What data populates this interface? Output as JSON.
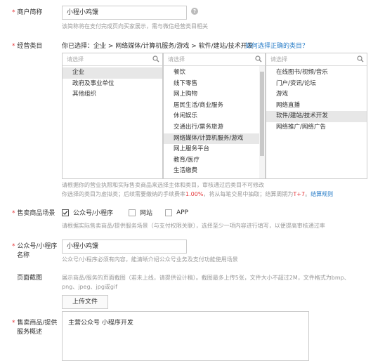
{
  "merchant_name": {
    "required_mark": "*",
    "label": "商户简称",
    "value": "小程小鸡馕",
    "help_glyph": "?",
    "hint": "该简称将在支付完成页向买家展示，需与微信经营类目相关"
  },
  "business_category": {
    "required_mark": "*",
    "label": "经营类目",
    "selected_path": "你已选择：企业 > 网络媒体/计算机服务/游戏 > 软件/建站/技术开发",
    "how_to_link": "如何选择正确的类目？",
    "columns": [
      {
        "placeholder": "请选择",
        "items": [
          {
            "label": "企业",
            "selected": true
          },
          {
            "label": "政府及事业单位",
            "selected": false
          },
          {
            "label": "其他组织",
            "selected": false
          }
        ]
      },
      {
        "placeholder": "请选择",
        "items": [
          {
            "label": "餐饮",
            "selected": false
          },
          {
            "label": "线下零售",
            "selected": false
          },
          {
            "label": "网上购物",
            "selected": false
          },
          {
            "label": "居民生活/商业服务",
            "selected": false
          },
          {
            "label": "休闲娱乐",
            "selected": false
          },
          {
            "label": "交通出行/票务旅游",
            "selected": false
          },
          {
            "label": "网络媒体/计算机服务/游戏",
            "selected": true
          },
          {
            "label": "网上服务平台",
            "selected": false
          },
          {
            "label": "教育/医疗",
            "selected": false
          },
          {
            "label": "生活缴费",
            "selected": false
          }
        ]
      },
      {
        "placeholder": "请选择",
        "items": [
          {
            "label": "在线图书/视频/音乐",
            "selected": false
          },
          {
            "label": "门户/资讯/论坛",
            "selected": false
          },
          {
            "label": "游戏",
            "selected": false
          },
          {
            "label": "网络直播",
            "selected": false
          },
          {
            "label": "软件/建站/技术开发",
            "selected": true
          },
          {
            "label": "网络推广/网络广告",
            "selected": false
          }
        ]
      }
    ],
    "note1": "请根据你的营业执照和实际售卖商品来选择主体和类目，审核通过后类目不可修改",
    "note2_prefix": "你选择的类目为虚拟类；后续需要缴纳的手续费率",
    "fee_rate": "1.00%",
    "note2_mid": "，将从每笔交易中抽取；结算周期为",
    "settle_period": "T+7",
    "note2_suffix": "。",
    "settle_rules_link": "结算规则"
  },
  "sales_scenario": {
    "required_mark": "*",
    "label": "售卖商品场景",
    "options": [
      {
        "label": "公众号/小程序",
        "checked": true
      },
      {
        "label": "网站",
        "checked": false
      },
      {
        "label": "APP",
        "checked": false
      }
    ],
    "hint": "请根据实际售卖商品/提供服务场景（与支付权限关联），选择至少一项内容进行填写，以便提高审核通过率"
  },
  "mp_name": {
    "required_mark": "*",
    "label_line1": "公众号/小程序",
    "label_line2": "名称",
    "value": "小程小鸡馕",
    "hint": "公众号/小程序必须有内容，能清晰介绍公众号业务及支付功能使用场景"
  },
  "screenshot": {
    "label": "页面截图",
    "hint_line1": "展示商品/服务的页面截图（若未上线，请提供设计稿）。截图最多上传5张，文件大小不超过2M，文件格式为bmp、",
    "hint_line2": "png、jpeg、jpg或gif",
    "upload_label": "上传文件"
  },
  "description": {
    "required_mark": "*",
    "label_line1": "售卖商品/提供",
    "label_line2": "服务概述",
    "value": "主营公众号 小程序开发"
  },
  "colors": {
    "required": "#e4393c",
    "link": "#2a7ec8",
    "hint": "#999999",
    "selected_row": "#e7e7e7"
  }
}
